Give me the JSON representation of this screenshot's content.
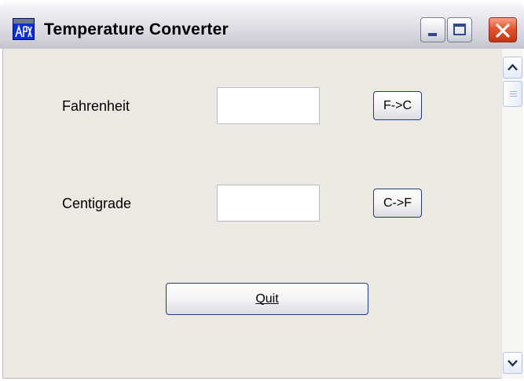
{
  "window": {
    "title": "Temperature Converter",
    "icons": [
      "app-icon",
      "minimize-icon",
      "maximize-icon",
      "close-icon"
    ]
  },
  "form": {
    "fahrenheit": {
      "label": "Fahrenheit",
      "value": "",
      "button_label": "F->C"
    },
    "centigrade": {
      "label": "Centigrade",
      "value": "",
      "button_label": "C->F"
    },
    "quit_label": "Quit"
  },
  "scrollbar": {
    "icons": [
      "scroll-up-icon",
      "scroll-down-icon"
    ]
  },
  "colors": {
    "client_background": "#ece9e3",
    "button_border": "#1e3b8a",
    "close_button": "#e2562e"
  }
}
